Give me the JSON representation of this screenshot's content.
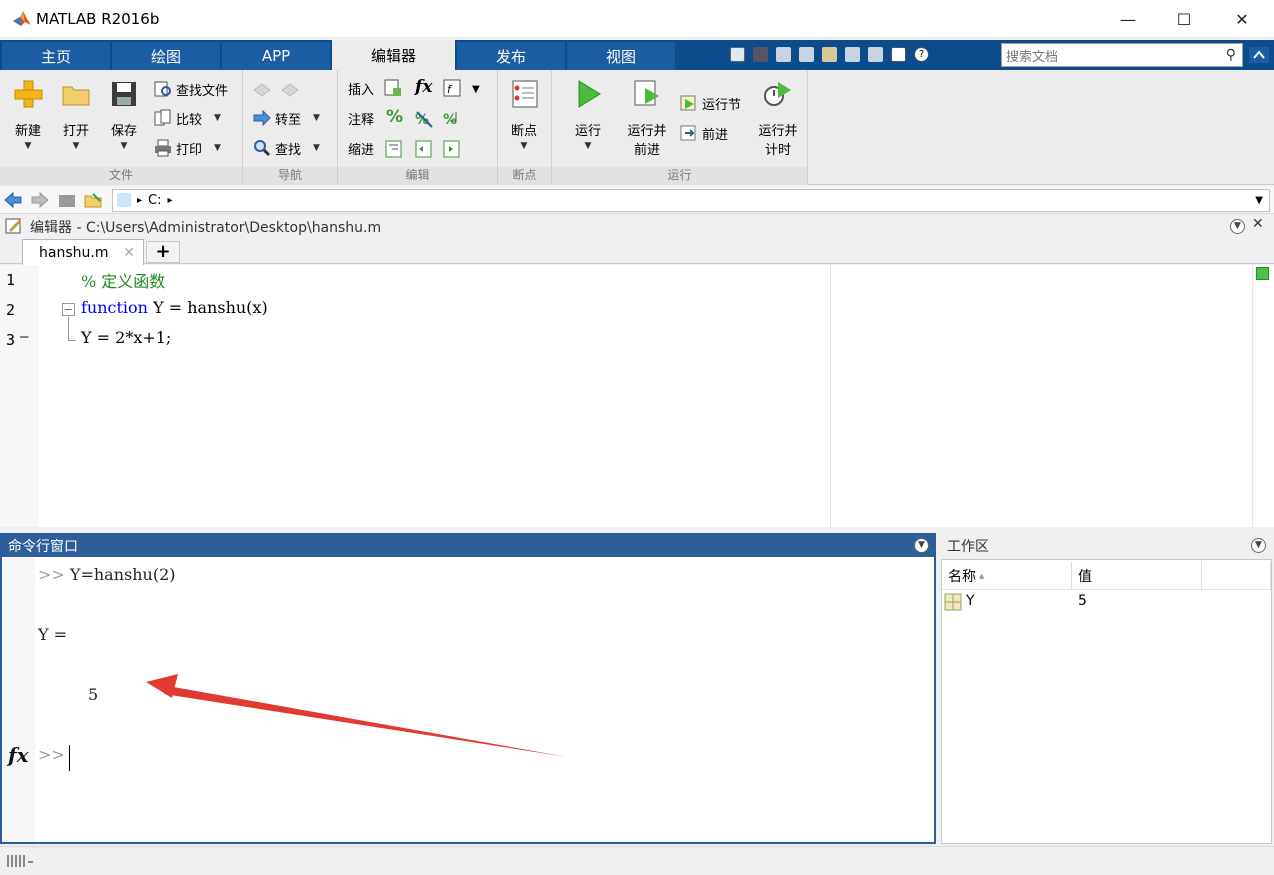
{
  "window": {
    "title": "MATLAB R2016b",
    "minimize": "—",
    "maximize": "☐",
    "close": "✕"
  },
  "ribbon_tabs": [
    {
      "label": "主页"
    },
    {
      "label": "绘图"
    },
    {
      "label": "APP"
    },
    {
      "label": "编辑器"
    },
    {
      "label": "发布"
    },
    {
      "label": "视图"
    }
  ],
  "search": {
    "placeholder": "搜索文档"
  },
  "ribbon": {
    "file": {
      "new": "新建",
      "open": "打开",
      "save": "保存",
      "find_files": "查找文件",
      "compare": "比较",
      "print": "打印",
      "group": "文件"
    },
    "nav": {
      "goto": "转至",
      "find": "查找",
      "group": "导航"
    },
    "edit": {
      "insert": "插入",
      "comment": "注释",
      "indent": "缩进",
      "fx": "fx",
      "percent": "%",
      "group": "编辑"
    },
    "breakpoints": {
      "label": "断点",
      "group": "断点"
    },
    "run": {
      "run": "运行",
      "run_advance_1": "运行并",
      "run_advance_2": "前进",
      "run_section": "运行节",
      "advance": "前进",
      "run_time_1": "运行并",
      "run_time_2": "计时",
      "group": "运行"
    }
  },
  "address": {
    "path": "C:",
    "sep": "▸"
  },
  "editor": {
    "header": "编辑器 - C:\\Users\\Administrator\\Desktop\\hanshu.m",
    "tab": "hanshu.m",
    "tab_close": "✕",
    "add_tab": "+",
    "lines": [
      {
        "num": "1",
        "text": "% 定义函数"
      },
      {
        "num": "2",
        "keyword": "function",
        "text": " Y = hanshu(x)"
      },
      {
        "num": "3",
        "text": "Y = 2*x+1;"
      }
    ],
    "line3_marker": "—"
  },
  "command_window": {
    "title": "命令行窗口",
    "prompt": ">>",
    "command": " Y=hanshu(2)",
    "output_var": "Y =",
    "output_value": "5",
    "fx": "fx"
  },
  "workspace": {
    "title": "工作区",
    "columns": [
      "名称",
      "值"
    ],
    "sort_indicator": "▲",
    "rows": [
      {
        "name": "Y",
        "value": "5"
      }
    ]
  },
  "colors": {
    "tab_bar": "#0d4c8c",
    "active_panel_header": "#2c5f99",
    "comment_green": "#228b22",
    "keyword_blue": "#0000ff",
    "annotation_arrow": "#e03a32"
  }
}
